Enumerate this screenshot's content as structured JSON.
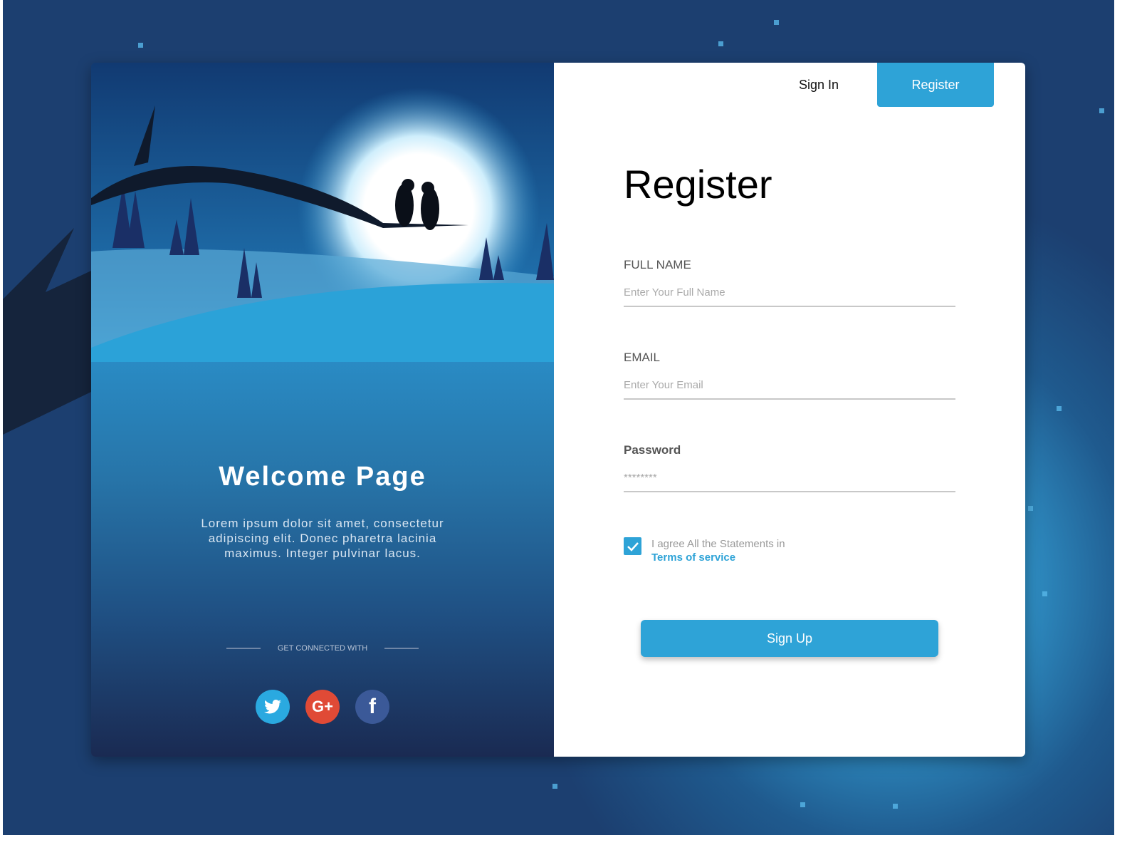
{
  "tabs": {
    "sign_in": "Sign In",
    "register": "Register"
  },
  "welcome": {
    "title": "Welcome Page",
    "text": "Lorem ipsum dolor sit amet, consectetur adipiscing elit. Donec pharetra lacinia maximus. Integer pulvinar lacus.",
    "connect_label": "GET CONNECTED WITH",
    "social": [
      {
        "icon": "twitter-icon",
        "glyph": "🐦",
        "color": "#2aa9e0"
      },
      {
        "icon": "google-plus-icon",
        "glyph": "G+",
        "color": "#e04a36"
      },
      {
        "icon": "facebook-icon",
        "glyph": "f",
        "color": "#3b5998"
      }
    ]
  },
  "form": {
    "title": "Register",
    "full_name": {
      "label": "FULL NAME",
      "placeholder": "Enter Your Full Name"
    },
    "email": {
      "label": "EMAIL",
      "placeholder": "Enter Your Email"
    },
    "password": {
      "label": "Password",
      "placeholder": "********"
    },
    "agree": {
      "checked": true,
      "text": "I agree All the Statements in",
      "link": "Terms of service"
    },
    "submit": "Sign Up"
  },
  "colors": {
    "accent": "#2ea3d7"
  }
}
